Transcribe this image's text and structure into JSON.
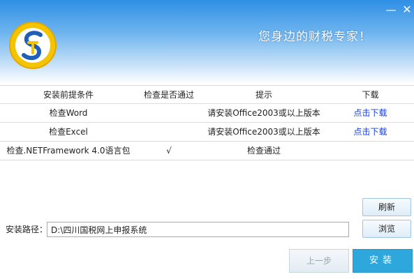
{
  "window": {
    "minimize_symbol": "—",
    "close_symbol": "✕"
  },
  "header": {
    "slogan": "您身边的财税专家！",
    "logo_icon": "shuiwu-logo-icon"
  },
  "table": {
    "headers": [
      "安装前提条件",
      "检查是否通过",
      "提示",
      "下载"
    ],
    "rows": [
      {
        "condition": "检查Word",
        "passed": "",
        "hint": "请安装Office2003或以上版本",
        "download": "点击下载"
      },
      {
        "condition": "检查Excel",
        "passed": "",
        "hint": "请安装Office2003或以上版本",
        "download": "点击下载"
      },
      {
        "condition": "检查.NETFramework 4.0语言包",
        "passed": "√",
        "hint": "检查通过",
        "download": ""
      }
    ]
  },
  "buttons": {
    "refresh": "刷新",
    "browse": "浏览",
    "previous": "上一步",
    "install": "安装"
  },
  "install_path": {
    "label": "安装路径：",
    "value": "D:\\四川国税网上申报系统"
  },
  "colors": {
    "header_top": "#2f8fe4",
    "link": "#1a3fd0",
    "install_button": "#2ea7dc",
    "logo_yellow": "#f5c400",
    "logo_blue": "#1f5fb8"
  }
}
